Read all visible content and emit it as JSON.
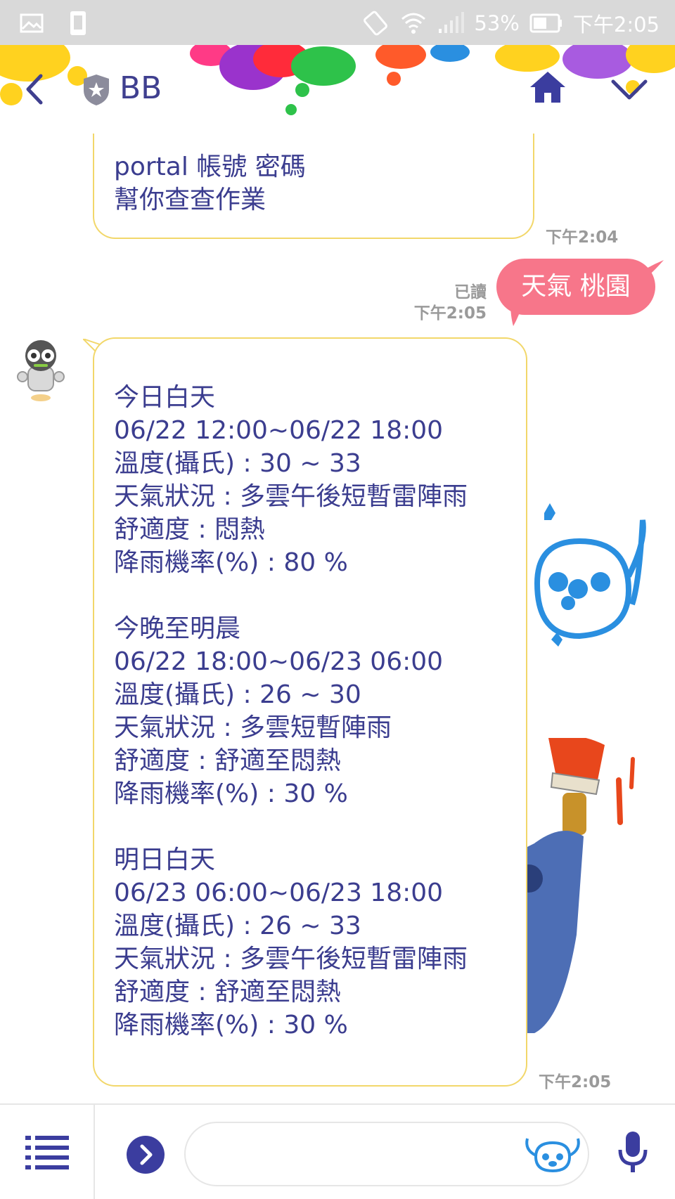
{
  "status_bar": {
    "battery": "53%",
    "time": "下午2:05",
    "icons": [
      "gallery-icon",
      "sim-icon",
      "rotate-icon",
      "wifi-icon",
      "signal-icon",
      "battery-icon"
    ]
  },
  "header": {
    "title": "BB",
    "icons": [
      "back-icon",
      "shield-icon",
      "home-icon",
      "chevron-down-icon"
    ],
    "accent": "#3f3f8f"
  },
  "messages": [
    {
      "from": "bot",
      "lines": [
        "portal 帳號 密碼",
        "幫你查查作業"
      ],
      "time": "下午2:04"
    },
    {
      "from": "me",
      "text": "天氣 桃園",
      "read": "已讀",
      "time": "下午2:05"
    },
    {
      "from": "bot",
      "lines": [
        "今日白天",
        "06/22 12:00~06/22 18:00",
        "溫度(攝氏) : 30 ~ 33",
        "天氣狀況 : 多雲午後短暫雷陣雨",
        "舒適度 : 悶熱",
        "降雨機率(%) : 80 %",
        "",
        "今晚至明晨",
        "06/22 18:00~06/23 06:00",
        "溫度(攝氏) : 26 ~ 30",
        "天氣狀況 : 多雲短暫陣雨",
        "舒適度 : 舒適至悶熱",
        "降雨機率(%) : 30 %",
        "",
        "明日白天",
        "06/23 06:00~06/23 18:00",
        "溫度(攝氏) : 26 ~ 33",
        "天氣狀況 : 多雲午後短暫雷陣雨",
        "舒適度 : 舒適至悶熱",
        "降雨機率(%) : 30 %"
      ],
      "time": "下午2:05"
    }
  ],
  "input_bar": {
    "placeholder": "",
    "icons": [
      "menu-icon",
      "expand-icon",
      "sticker-icon",
      "mic-icon"
    ]
  },
  "colors": {
    "bot_text": "#3b3d8f",
    "bot_border": "#f2d76a",
    "me_bubble": "#f7768a",
    "timestamp": "#9a9a9a"
  }
}
